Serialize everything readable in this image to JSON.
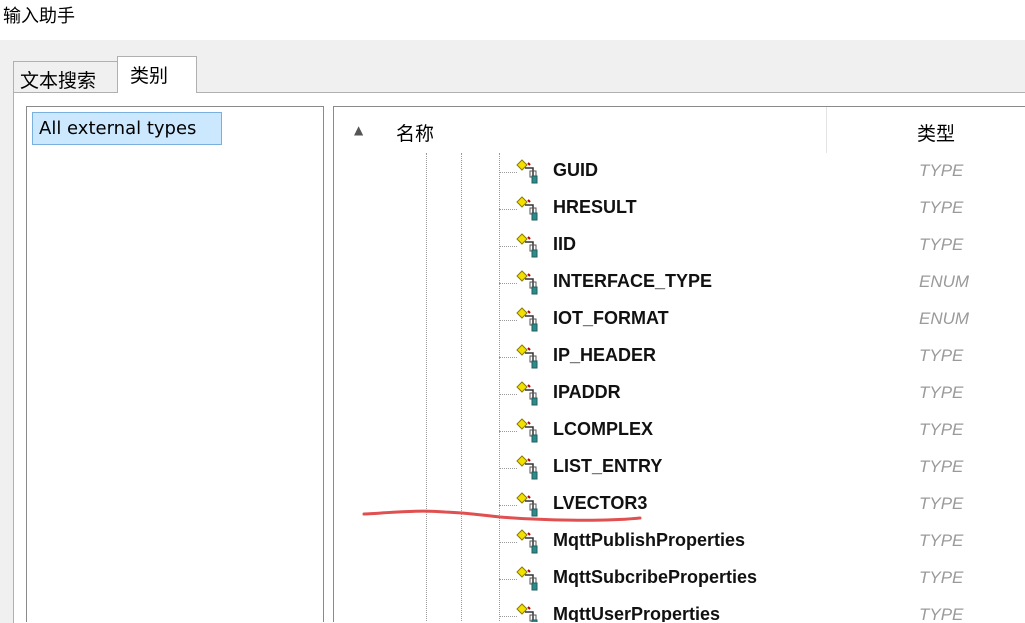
{
  "window": {
    "title": "输入助手"
  },
  "tabs": [
    {
      "label": "文本搜索"
    },
    {
      "label": "类别"
    }
  ],
  "categories": [
    {
      "label": "All external types"
    }
  ],
  "list": {
    "header_name": "名称",
    "header_type": "类型",
    "rows": [
      {
        "name": "GUID",
        "type": "TYPE"
      },
      {
        "name": "HRESULT",
        "type": "TYPE"
      },
      {
        "name": "IID",
        "type": "TYPE"
      },
      {
        "name": "INTERFACE_TYPE",
        "type": "ENUM"
      },
      {
        "name": "IOT_FORMAT",
        "type": "ENUM"
      },
      {
        "name": "IP_HEADER",
        "type": "TYPE"
      },
      {
        "name": "IPADDR",
        "type": "TYPE"
      },
      {
        "name": "LCOMPLEX",
        "type": "TYPE"
      },
      {
        "name": "LIST_ENTRY",
        "type": "TYPE"
      },
      {
        "name": "LVECTOR3",
        "type": "TYPE"
      },
      {
        "name": "MqttPublishProperties",
        "type": "TYPE"
      },
      {
        "name": "MqttSubcribeProperties",
        "type": "TYPE"
      },
      {
        "name": "MqttUserProperties",
        "type": "TYPE"
      }
    ]
  },
  "colors": {
    "selection": "#cce8ff",
    "annotation": "#e05050",
    "type_text": "#9a9a9a"
  },
  "icons": [
    "sort-ascending-icon",
    "struct-type-icon"
  ]
}
